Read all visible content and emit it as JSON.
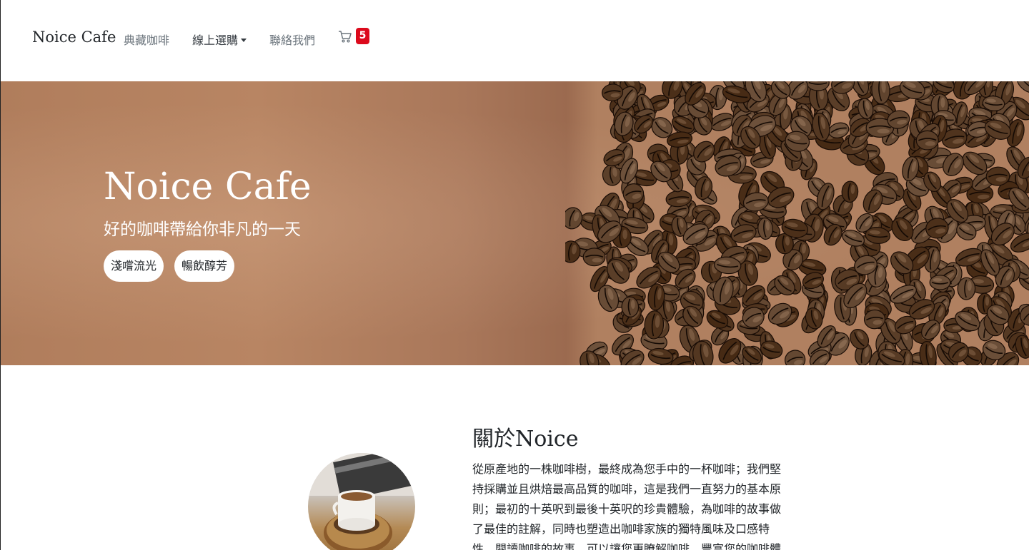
{
  "navbar": {
    "brand": "Noice Cafe",
    "links": [
      "典藏咖啡",
      "線上選購",
      "聯絡我們"
    ],
    "cart_count": "5"
  },
  "hero": {
    "title": "Noice Cafe",
    "subtitle": "好的咖啡帶給你非凡的一天",
    "buttons": [
      "淺嚐流光",
      "暢飲醇芳"
    ]
  },
  "about": {
    "title": "關於Noice",
    "text": "從原產地的一株咖啡樹，最終成為您手中的一杯咖啡；我們堅持採購並且烘焙最高品質的咖啡，這是我們一直努力的基本原則；最初的十英呎到最後十英呎的珍貴體驗，為咖啡的故事做了最佳的註解，同時也塑造出咖啡家族的獨特風味及口感特性，閱讀咖啡的故事，可以讓您更瞭解咖啡，豐富您的咖啡體"
  },
  "icons": {
    "cart": "cart-icon",
    "dropdown": "caret-down-icon"
  },
  "colors": {
    "badge": "#dc0a1c",
    "hero_bg": "#b07d5c"
  }
}
